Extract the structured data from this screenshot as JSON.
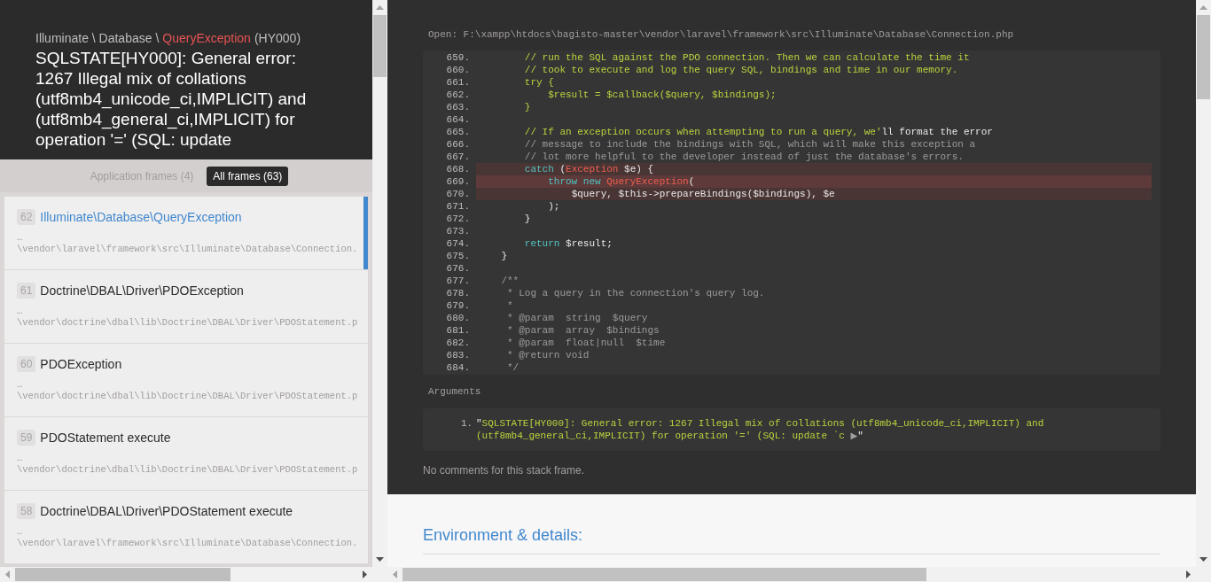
{
  "exception": {
    "namespace": "Illuminate \\ Database \\",
    "class": "QueryException",
    "code": "(HY000)",
    "message": "SQLSTATE[HY000]: General error: 1267 Illegal mix of collations (utf8mb4_unicode_ci,IMPLICIT) and (utf8mb4_general_ci,IMPLICIT) for operation '=' (SQL: update"
  },
  "frame_tabs": [
    {
      "label": "Application frames (4)",
      "selected": false
    },
    {
      "label": "All frames (63)",
      "selected": true
    }
  ],
  "frames": [
    {
      "index": "62",
      "name": "Illuminate\\Database\\QueryException",
      "ellipsis": "…",
      "path": "\\vendor\\laravel\\framework\\src\\Illuminate\\Database\\Connection.",
      "selected": true
    },
    {
      "index": "61",
      "name": "Doctrine\\DBAL\\Driver\\PDOException",
      "ellipsis": "…",
      "path": "\\vendor\\doctrine\\dbal\\lib\\Doctrine\\DBAL\\Driver\\PDOStatement.p",
      "selected": false
    },
    {
      "index": "60",
      "name": "PDOException",
      "ellipsis": "…",
      "path": "\\vendor\\doctrine\\dbal\\lib\\Doctrine\\DBAL\\Driver\\PDOStatement.p",
      "selected": false
    },
    {
      "index": "59",
      "name": "PDOStatement execute",
      "ellipsis": "…",
      "path": "\\vendor\\doctrine\\dbal\\lib\\Doctrine\\DBAL\\Driver\\PDOStatement.p",
      "selected": false
    },
    {
      "index": "58",
      "name": "Doctrine\\DBAL\\Driver\\PDOStatement execute",
      "ellipsis": "…",
      "path": "\\vendor\\laravel\\framework\\src\\Illuminate\\Database\\Connection.",
      "selected": false
    }
  ],
  "code": {
    "open_path": "Open: F:\\xampp\\htdocs\\bagisto-master\\vendor\\laravel\\framework\\src\\Illuminate\\Database\\Connection.php",
    "lines": [
      {
        "number": "659.",
        "highlighted": false,
        "error_line": false,
        "tokens": [
          {
            "kind": "string",
            "text": "        // run the SQL against the PDO connection. Then we can calculate the time it"
          }
        ]
      },
      {
        "number": "660.",
        "highlighted": false,
        "error_line": false,
        "tokens": [
          {
            "kind": "string",
            "text": "        // took to execute and log the query SQL, bindings and time in our memory."
          }
        ]
      },
      {
        "number": "661.",
        "highlighted": false,
        "error_line": false,
        "tokens": [
          {
            "kind": "string",
            "text": "        try {"
          }
        ]
      },
      {
        "number": "662.",
        "highlighted": false,
        "error_line": false,
        "tokens": [
          {
            "kind": "string",
            "text": "            $result = $callback($query, $bindings);"
          }
        ]
      },
      {
        "number": "663.",
        "highlighted": false,
        "error_line": false,
        "tokens": [
          {
            "kind": "string",
            "text": "        }"
          }
        ]
      },
      {
        "number": "664.",
        "highlighted": false,
        "error_line": false
      },
      {
        "number": "665.",
        "highlighted": false,
        "error_line": false,
        "tokens": [
          {
            "kind": "string",
            "text": "        // If an exception occurs when attempting to run a query, we'"
          },
          {
            "kind": "plain",
            "text": "ll format the error"
          }
        ]
      },
      {
        "number": "666.",
        "highlighted": false,
        "error_line": false,
        "tokens": [
          {
            "kind": "comment",
            "text": "        // message to include the bindings with SQL, which will make this exception a"
          }
        ]
      },
      {
        "number": "667.",
        "highlighted": false,
        "error_line": false,
        "tokens": [
          {
            "kind": "comment",
            "text": "        // lot more helpful to the developer instead of just the database's errors."
          }
        ]
      },
      {
        "number": "668.",
        "highlighted": true,
        "error_line": false,
        "tokens": [
          {
            "kind": "keyword",
            "text": "        catch"
          },
          {
            "kind": "plain",
            "text": " ("
          },
          {
            "kind": "type",
            "text": "Exception"
          },
          {
            "kind": "plain",
            "text": " $e) {"
          }
        ]
      },
      {
        "number": "669.",
        "highlighted": true,
        "error_line": true,
        "tokens": [
          {
            "kind": "keyword",
            "text": "            throw new "
          },
          {
            "kind": "type",
            "text": "QueryException"
          },
          {
            "kind": "plain",
            "text": "("
          }
        ]
      },
      {
        "number": "670.",
        "highlighted": true,
        "error_line": false,
        "tokens": [
          {
            "kind": "plain",
            "text": "                $query, $this->prepareBindings($bindings), $e"
          }
        ]
      },
      {
        "number": "671.",
        "highlighted": false,
        "error_line": false,
        "tokens": [
          {
            "kind": "plain",
            "text": "            );"
          }
        ]
      },
      {
        "number": "672.",
        "highlighted": false,
        "error_line": false,
        "tokens": [
          {
            "kind": "plain",
            "text": "        }"
          }
        ]
      },
      {
        "number": "673.",
        "highlighted": false,
        "error_line": false
      },
      {
        "number": "674.",
        "highlighted": false,
        "error_line": false,
        "tokens": [
          {
            "kind": "keyword",
            "text": "        return "
          },
          {
            "kind": "plain",
            "text": "$result;"
          }
        ]
      },
      {
        "number": "675.",
        "highlighted": false,
        "error_line": false,
        "tokens": [
          {
            "kind": "plain",
            "text": "    }"
          }
        ]
      },
      {
        "number": "676.",
        "highlighted": false,
        "error_line": false
      },
      {
        "number": "677.",
        "highlighted": false,
        "error_line": false,
        "tokens": [
          {
            "kind": "comment",
            "text": "    /**"
          }
        ]
      },
      {
        "number": "678.",
        "highlighted": false,
        "error_line": false,
        "tokens": [
          {
            "kind": "comment",
            "text": "     * Log a query in the connection's query log."
          }
        ]
      },
      {
        "number": "679.",
        "highlighted": false,
        "error_line": false,
        "tokens": [
          {
            "kind": "comment",
            "text": "     *"
          }
        ]
      },
      {
        "number": "680.",
        "highlighted": false,
        "error_line": false,
        "tokens": [
          {
            "kind": "comment",
            "text": "     * @param  string  $query"
          }
        ]
      },
      {
        "number": "681.",
        "highlighted": false,
        "error_line": false,
        "tokens": [
          {
            "kind": "comment",
            "text": "     * @param  array  $bindings"
          }
        ]
      },
      {
        "number": "682.",
        "highlighted": false,
        "error_line": false,
        "tokens": [
          {
            "kind": "comment",
            "text": "     * @param  float|null  $time"
          }
        ]
      },
      {
        "number": "683.",
        "highlighted": false,
        "error_line": false,
        "tokens": [
          {
            "kind": "comment",
            "text": "     * @return void"
          }
        ]
      },
      {
        "number": "684.",
        "highlighted": false,
        "error_line": false,
        "tokens": [
          {
            "kind": "comment",
            "text": "     */"
          }
        ]
      }
    ]
  },
  "arguments": {
    "label": "Arguments",
    "items": [
      {
        "number": "1.",
        "open_quote": "\"",
        "value": "SQLSTATE[HY000]: General error: 1267 Illegal mix of collations (utf8mb4_unicode_ci,IMPLICIT) and (utf8mb4_general_ci,IMPLICIT) for operation '=' (SQL: update `c",
        "toggle": "▶",
        "close_quote": "\""
      }
    ]
  },
  "comments": "No comments for this stack frame.",
  "environment": {
    "heading": "Environment & details:"
  }
}
